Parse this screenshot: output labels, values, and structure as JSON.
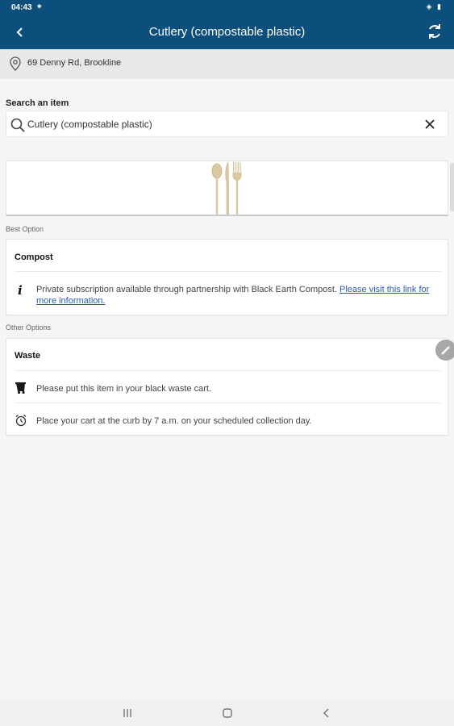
{
  "status_bar": {
    "time": "04:43",
    "notif": "✷",
    "right": "◈ ▮"
  },
  "app_bar": {
    "title": "Cutlery (compostable plastic)",
    "back": "back-arrow-icon",
    "refresh": "refresh-icon"
  },
  "address": {
    "text": "69 Denny Rd, Brookline",
    "icon": "location-pin-icon"
  },
  "search": {
    "label": "Search an item",
    "value": "Cutlery (compostable plastic)",
    "placeholder": "Search an item",
    "icon": "search-icon",
    "clear": "close-icon"
  },
  "hero": {
    "image": "cutlery-icon"
  },
  "best_option": {
    "section_label": "Best Option",
    "title": "Compost",
    "info_text": "Private subscription available through partnership with Black Earth Compost.",
    "link_text": "Please visit this link for more information.",
    "icon": "info-icon"
  },
  "other_options": {
    "section_label": "Other Options",
    "title": "Waste",
    "rows": [
      {
        "icon": "waste-cart-icon",
        "text": "Please put this item in your black waste cart."
      },
      {
        "icon": "alarm-clock-icon",
        "text": "Place your cart at the curb by 7 a.m. on your scheduled collection day."
      }
    ]
  },
  "nav": {
    "recents": "recents-icon",
    "home": "home-icon",
    "back": "back-icon"
  },
  "colors": {
    "primary": "#0d4f7c",
    "link": "#2a5db0",
    "background": "#f5f5f5"
  }
}
